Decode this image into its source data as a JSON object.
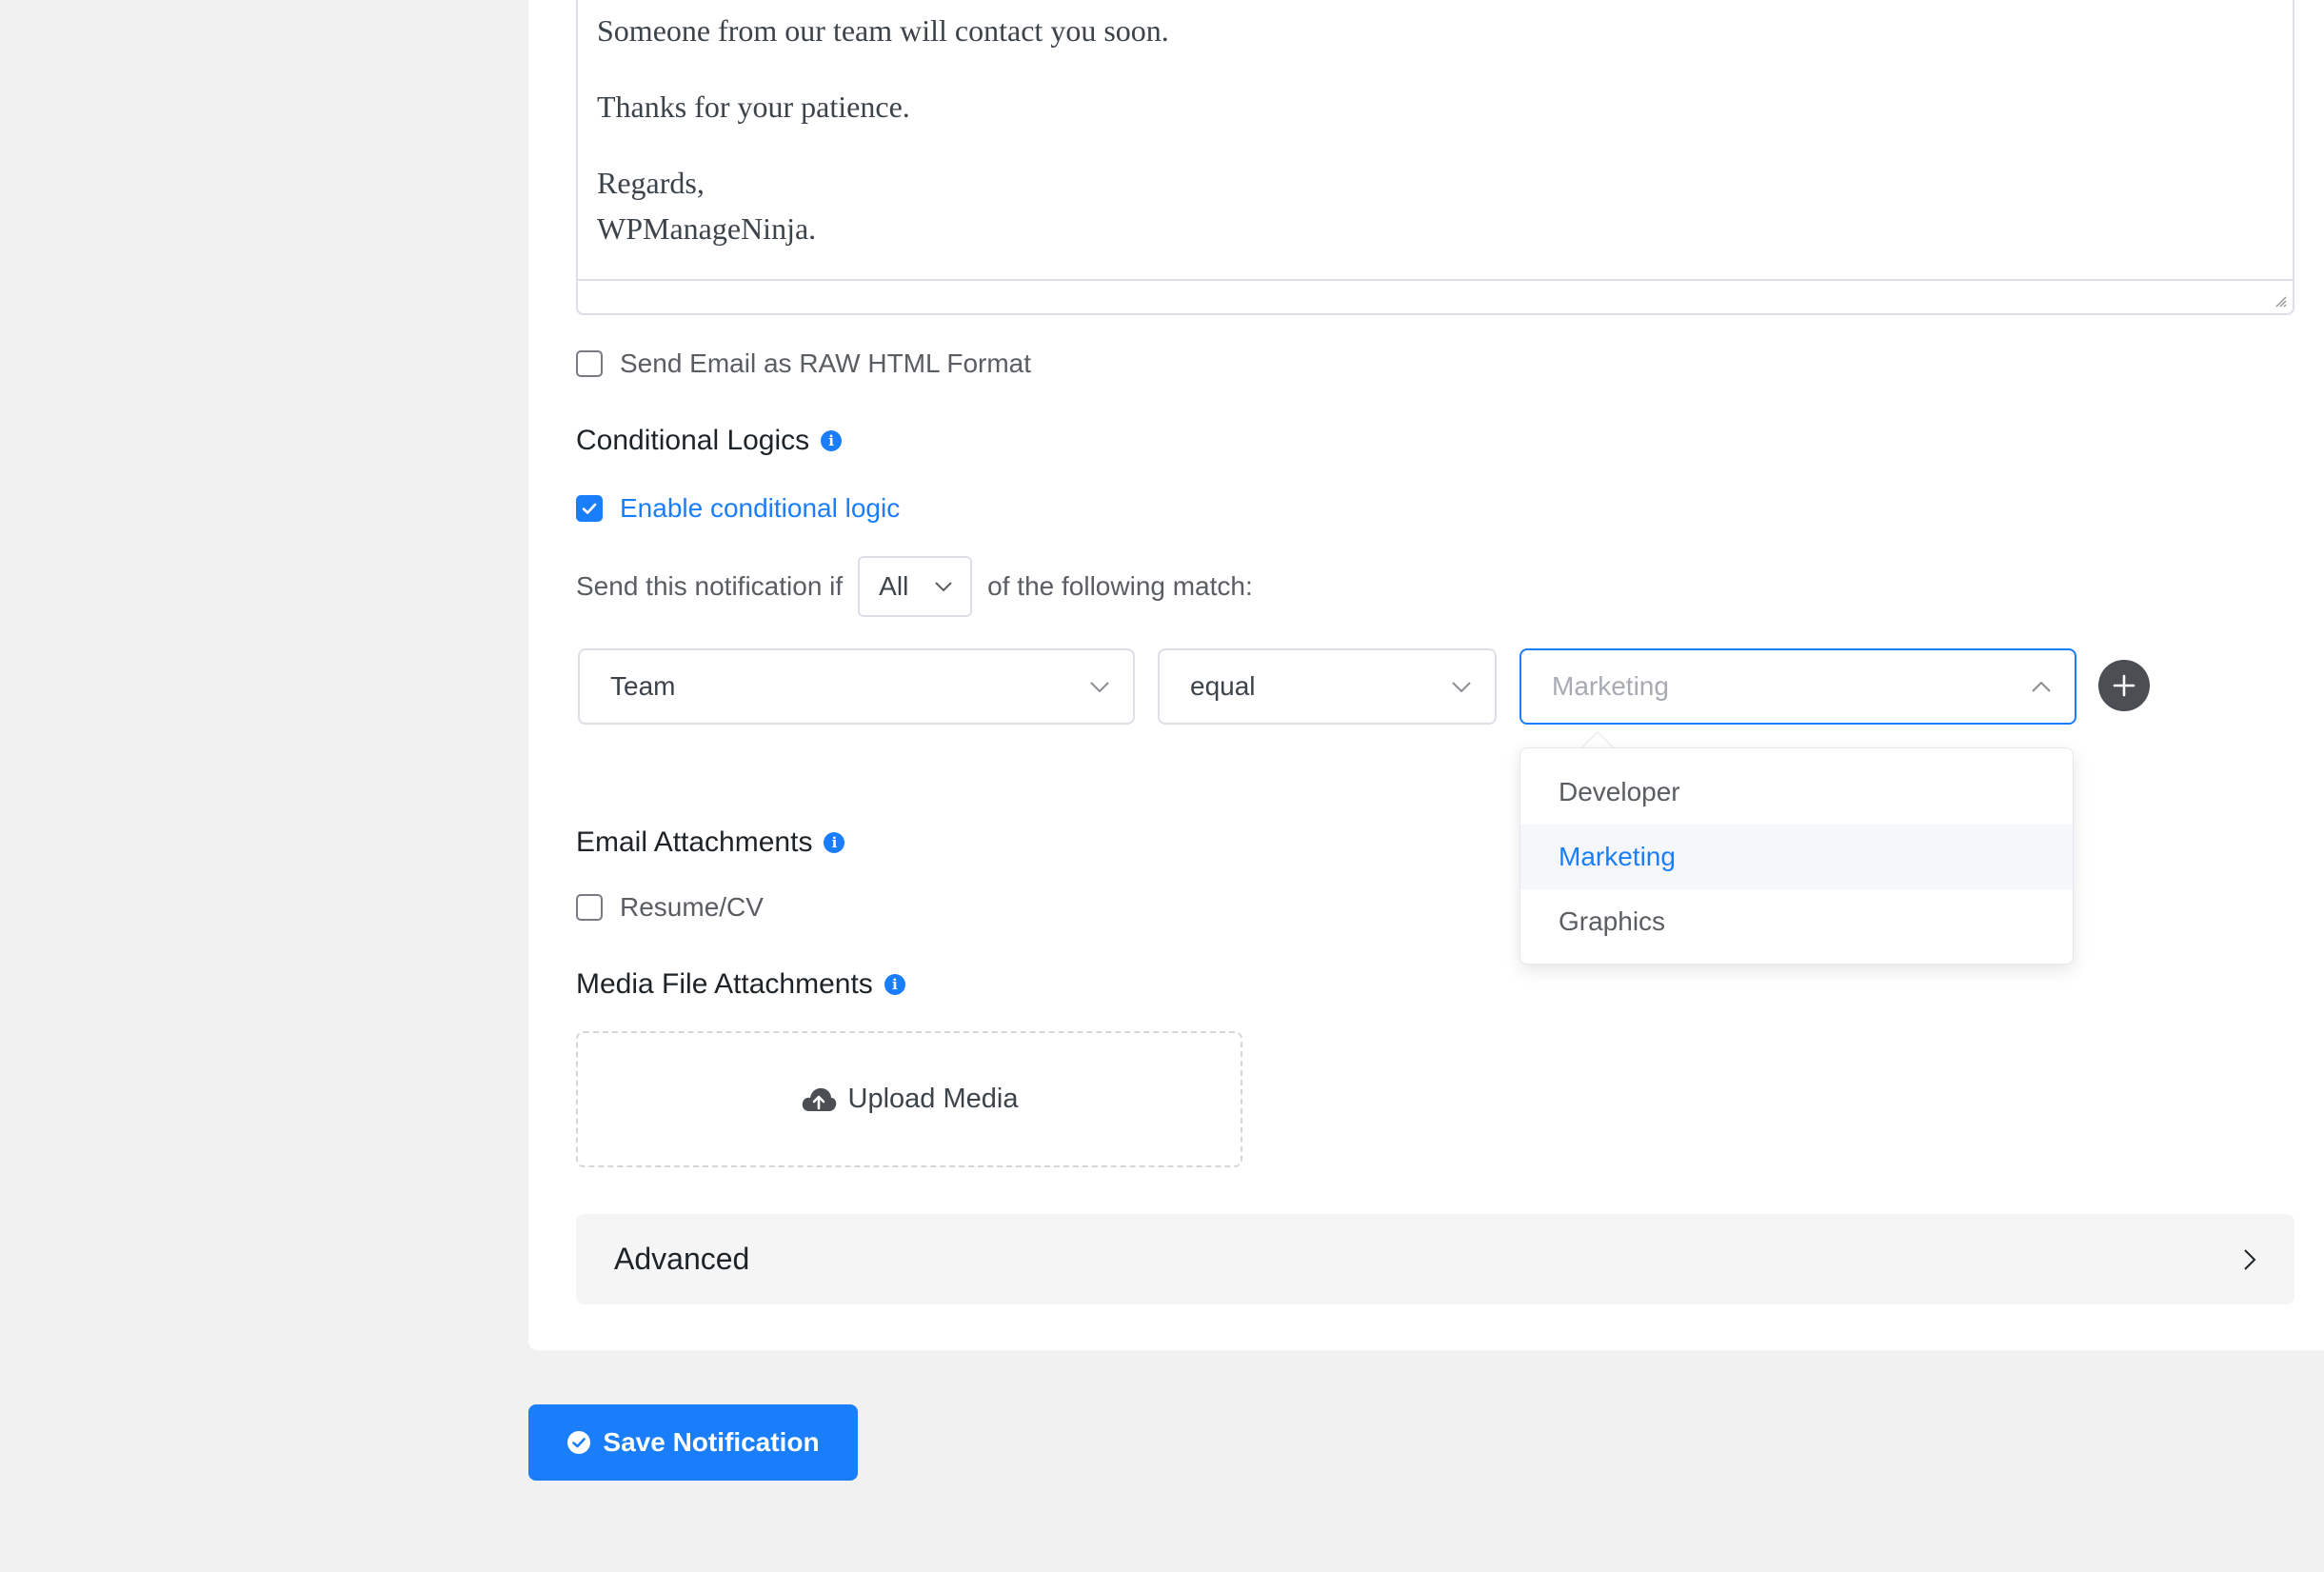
{
  "editor": {
    "lines": [
      "Someone from our team will contact you soon.",
      "Thanks for your patience.",
      "Regards,",
      "WPManageNinja."
    ]
  },
  "raw_html": {
    "label": "Send Email as RAW HTML Format",
    "checked": false
  },
  "conditional": {
    "title": "Conditional Logics",
    "enable_label": "Enable conditional logic",
    "enable_checked": true,
    "prefix": "Send this notification if",
    "match_value": "All",
    "suffix": "of the following match:",
    "rule": {
      "field": "Team",
      "operator": "equal",
      "value_placeholder": "Marketing"
    },
    "options": [
      "Developer",
      "Marketing",
      "Graphics"
    ],
    "selected_option": "Marketing"
  },
  "attachments": {
    "title": "Email Attachments",
    "items": [
      {
        "label": "Resume/CV",
        "checked": false
      }
    ]
  },
  "media": {
    "title": "Media File Attachments",
    "upload_label": "Upload Media"
  },
  "advanced": {
    "label": "Advanced"
  },
  "save": {
    "label": "Save Notification"
  },
  "colors": {
    "accent": "#1a7efb",
    "background": "#f1f1f1",
    "panel": "#ffffff"
  }
}
